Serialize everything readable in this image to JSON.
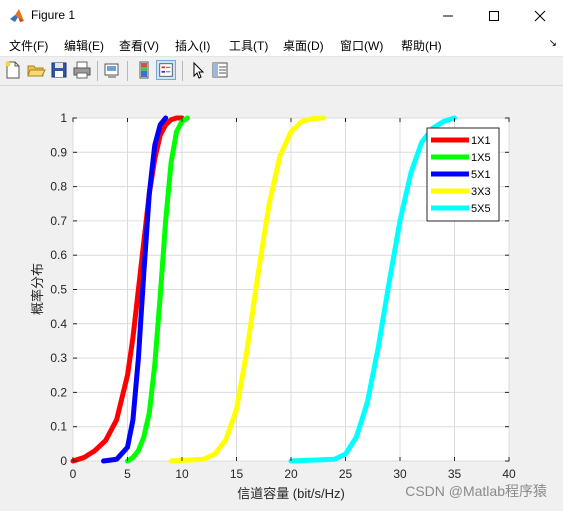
{
  "window": {
    "title": "Figure 1"
  },
  "menu": [
    "文件(F)",
    "编辑(E)",
    "查看(V)",
    "插入(I)",
    "工具(T)",
    "桌面(D)",
    "窗口(W)",
    "帮助(H)"
  ],
  "toolbar": {
    "buttons": [
      "new-figure",
      "open-file",
      "save",
      "print",
      "link-plot",
      "insert-colorbar",
      "insert-legend",
      "edit-plot",
      "property-inspector"
    ]
  },
  "watermark": "CSDN @Matlab程序猿",
  "chart_data": {
    "type": "line",
    "title": "",
    "xlabel": "信道容量 (bit/s/Hz)",
    "ylabel": "概率分布",
    "xlim": [
      0,
      40
    ],
    "ylim": [
      0,
      1
    ],
    "xticks": [
      "0",
      "5",
      "10",
      "15",
      "20",
      "25",
      "30",
      "35",
      "40"
    ],
    "yticks": [
      "0",
      "0.1",
      "0.2",
      "0.3",
      "0.4",
      "0.5",
      "0.6",
      "0.7",
      "0.8",
      "0.9",
      "1"
    ],
    "grid": true,
    "legend_position": "top-right",
    "series": [
      {
        "name": "1X1",
        "color": "#ff0000",
        "x": [
          0,
          1,
          2,
          3,
          4,
          5,
          5.5,
          6,
          6.5,
          7,
          7.5,
          8,
          8.5,
          9,
          9.5,
          10
        ],
        "y": [
          0,
          0.01,
          0.03,
          0.06,
          0.12,
          0.25,
          0.36,
          0.5,
          0.64,
          0.78,
          0.88,
          0.95,
          0.98,
          0.995,
          1,
          1
        ]
      },
      {
        "name": "1X5",
        "color": "#00ff00",
        "x": [
          5,
          5.5,
          6,
          6.5,
          7,
          7.5,
          8,
          8.5,
          9,
          9.5,
          10,
          10.5
        ],
        "y": [
          0,
          0.01,
          0.03,
          0.07,
          0.14,
          0.28,
          0.48,
          0.7,
          0.87,
          0.96,
          0.99,
          1
        ]
      },
      {
        "name": "5X1",
        "color": "#0000ff",
        "x": [
          2.8,
          4,
          5,
          5.5,
          6,
          6.5,
          7,
          7.5,
          8,
          8.5
        ],
        "y": [
          0,
          0.005,
          0.04,
          0.12,
          0.3,
          0.55,
          0.78,
          0.92,
          0.98,
          1
        ]
      },
      {
        "name": "3X3",
        "color": "#ffff00",
        "x": [
          9,
          12,
          13,
          14,
          15,
          16,
          17,
          18,
          19,
          20,
          21,
          22,
          23
        ],
        "y": [
          0,
          0.005,
          0.02,
          0.06,
          0.15,
          0.33,
          0.55,
          0.75,
          0.89,
          0.96,
          0.99,
          0.998,
          1
        ]
      },
      {
        "name": "5X5",
        "color": "#00ffff",
        "x": [
          20,
          24,
          25,
          26,
          27,
          28,
          29,
          30,
          31,
          32,
          33,
          34,
          35
        ],
        "y": [
          0,
          0.005,
          0.02,
          0.07,
          0.17,
          0.33,
          0.52,
          0.7,
          0.84,
          0.93,
          0.97,
          0.99,
          1
        ]
      }
    ]
  }
}
